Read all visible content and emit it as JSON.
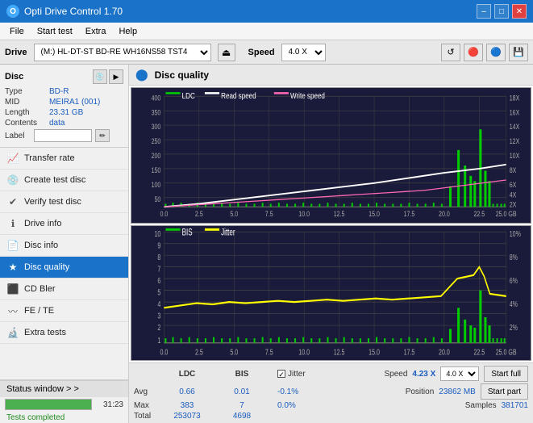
{
  "titlebar": {
    "icon": "O",
    "title": "Opti Drive Control 1.70",
    "min": "–",
    "max": "□",
    "close": "✕"
  },
  "menubar": {
    "items": [
      "File",
      "Start test",
      "Extra",
      "Help"
    ]
  },
  "drivebar": {
    "label": "Drive",
    "drive_value": "(M:)  HL-DT-ST BD-RE  WH16NS58 TST4",
    "speed_label": "Speed",
    "speed_value": "4.0 X"
  },
  "disc": {
    "label": "Disc",
    "type_key": "Type",
    "type_val": "BD-R",
    "mid_key": "MID",
    "mid_val": "MEIRA1 (001)",
    "length_key": "Length",
    "length_val": "23.31 GB",
    "contents_key": "Contents",
    "contents_val": "data",
    "label_key": "Label",
    "label_val": ""
  },
  "nav": {
    "items": [
      {
        "id": "transfer-rate",
        "label": "Transfer rate",
        "icon": "📈"
      },
      {
        "id": "create-test-disc",
        "label": "Create test disc",
        "icon": "💿"
      },
      {
        "id": "verify-test-disc",
        "label": "Verify test disc",
        "icon": "✔"
      },
      {
        "id": "drive-info",
        "label": "Drive info",
        "icon": "ℹ"
      },
      {
        "id": "disc-info",
        "label": "Disc info",
        "icon": "📄"
      },
      {
        "id": "disc-quality",
        "label": "Disc quality",
        "icon": "★",
        "active": true
      },
      {
        "id": "cd-bler",
        "label": "CD Bler",
        "icon": "⬛"
      },
      {
        "id": "fe-te",
        "label": "FE / TE",
        "icon": "〰"
      },
      {
        "id": "extra-tests",
        "label": "Extra tests",
        "icon": "🔬"
      }
    ]
  },
  "status": {
    "window_label": "Status window > >",
    "progress": 100,
    "time": "31:23",
    "message": "Tests completed"
  },
  "disc_quality": {
    "title": "Disc quality",
    "chart1": {
      "legend": [
        {
          "label": "LDC",
          "color": "#00cc00"
        },
        {
          "label": "Read speed",
          "color": "#ffffff"
        },
        {
          "label": "Write speed",
          "color": "#ff69b4"
        }
      ],
      "y_max": 400,
      "y_labels": [
        "400",
        "350",
        "300",
        "250",
        "200",
        "150",
        "100",
        "50"
      ],
      "y_right_labels": [
        "18X",
        "16X",
        "14X",
        "12X",
        "10X",
        "8X",
        "6X",
        "4X",
        "2X"
      ],
      "x_labels": [
        "0.0",
        "2.5",
        "5.0",
        "7.5",
        "10.0",
        "12.5",
        "15.0",
        "17.5",
        "20.0",
        "22.5",
        "25.0 GB"
      ]
    },
    "chart2": {
      "legend": [
        {
          "label": "BIS",
          "color": "#00cc00"
        },
        {
          "label": "Jitter",
          "color": "#ffff00"
        }
      ],
      "y_max": 10,
      "y_labels": [
        "10",
        "9",
        "8",
        "7",
        "6",
        "5",
        "4",
        "3",
        "2",
        "1"
      ],
      "y_right_labels": [
        "10%",
        "8%",
        "6%",
        "4%",
        "2%"
      ],
      "x_labels": [
        "0.0",
        "2.5",
        "5.0",
        "7.5",
        "10.0",
        "12.5",
        "15.0",
        "17.5",
        "20.0",
        "22.5",
        "25.0 GB"
      ]
    }
  },
  "stats": {
    "col_ldc": "LDC",
    "col_bis": "BIS",
    "jitter_label": "Jitter",
    "speed_label": "Speed",
    "speed_val": "4.23 X",
    "speed_select": "4.0 X",
    "avg_label": "Avg",
    "avg_ldc": "0.66",
    "avg_bis": "0.01",
    "avg_jitter": "-0.1%",
    "max_label": "Max",
    "max_ldc": "383",
    "max_bis": "7",
    "max_jitter": "0.0%",
    "total_label": "Total",
    "total_ldc": "253073",
    "total_bis": "4698",
    "position_label": "Position",
    "position_val": "23862 MB",
    "samples_label": "Samples",
    "samples_val": "381701",
    "start_full": "Start full",
    "start_part": "Start part"
  }
}
